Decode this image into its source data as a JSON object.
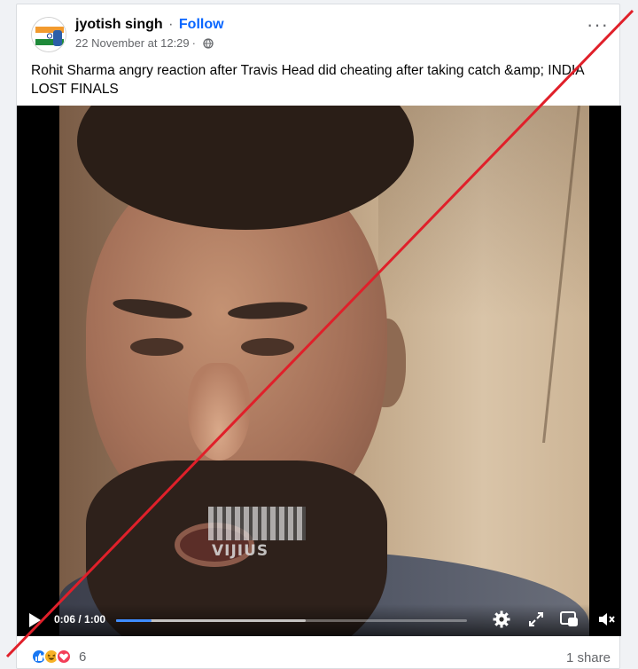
{
  "post": {
    "author_name": "jyotish singh",
    "separator": "·",
    "follow_label": "Follow",
    "timestamp": "22 November at 12:29",
    "timestamp_sep": "·",
    "more_label": "···",
    "text": "Rohit Sharma angry reaction after Travis Head did cheating after taking catch &amp; INDIA LOST FINALS"
  },
  "video": {
    "watermark_text": "VIJIUS",
    "current_time": "0:06",
    "duration": "1:00",
    "time_display": "0:06 / 1:00",
    "progress_fraction": 0.1,
    "buffered_fraction": 0.54,
    "controls": [
      "play-icon",
      "settings-icon",
      "fullscreen-icon",
      "picture-in-picture-icon",
      "mute-icon"
    ]
  },
  "footer": {
    "reaction_icons": [
      "like-icon",
      "haha-icon",
      "love-icon"
    ],
    "reaction_count": "6",
    "shares_label": "1 share"
  },
  "colors": {
    "accent": "#0866ff",
    "cross_line": "#e0202a",
    "progress": "#3f8cff"
  }
}
